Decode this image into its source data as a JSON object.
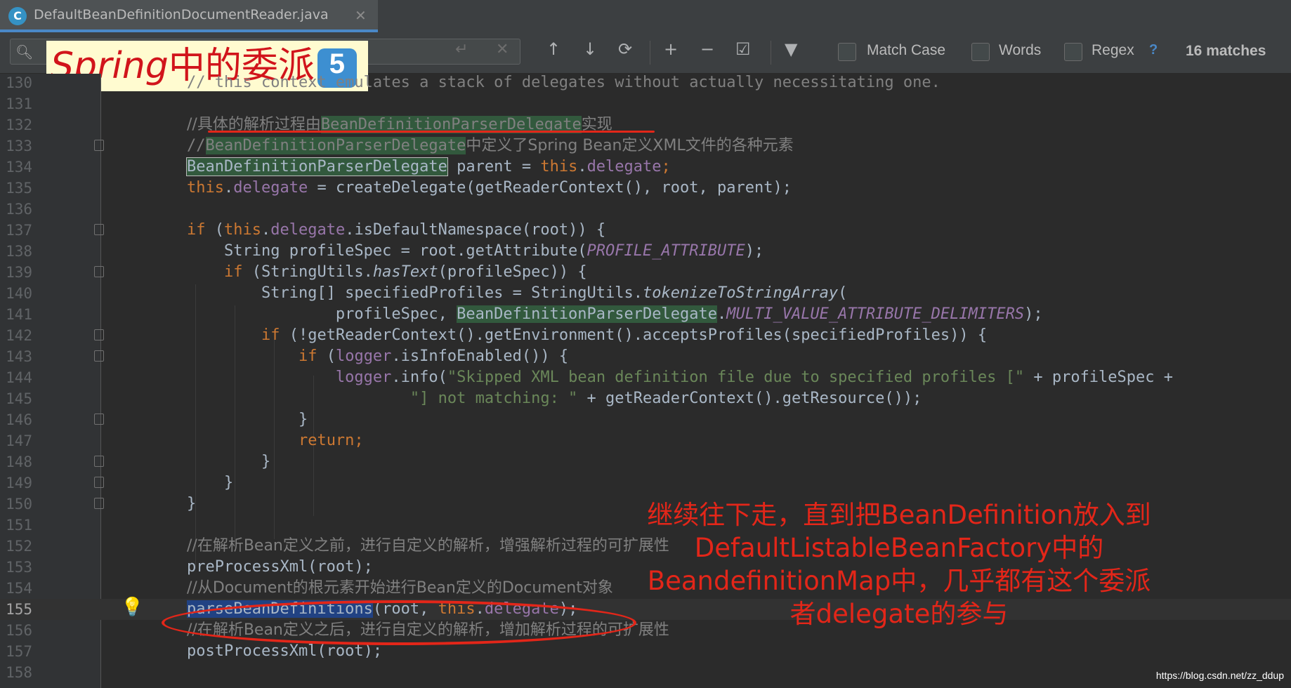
{
  "tab": {
    "icon_letter": "C",
    "title": "DefaultBeanDefinitionDocumentReader.java",
    "close": "✕"
  },
  "find": {
    "search_icon": "search-icon",
    "search_glyph": "🔍︎",
    "query": "",
    "enter_glyph": "↵",
    "clear_glyph": "✕",
    "up_glyph": "↑",
    "down_glyph": "↓",
    "all_glyph": "⟳",
    "add_glyph": "+",
    "remove_glyph": "−",
    "select_glyph": "☑",
    "filter_glyph": "▼",
    "match_case": "Match Case",
    "words": "Words",
    "regex": "Regex",
    "help": "?",
    "matches": "16 matches"
  },
  "overlay": {
    "title_latin": "Spring",
    "title_cjk": "中的委派",
    "badge": "5"
  },
  "lines": [
    {
      "n": "130"
    },
    {
      "n": "131"
    },
    {
      "n": "132"
    },
    {
      "n": "133"
    },
    {
      "n": "134"
    },
    {
      "n": "135"
    },
    {
      "n": "136"
    },
    {
      "n": "137"
    },
    {
      "n": "138"
    },
    {
      "n": "139"
    },
    {
      "n": "140"
    },
    {
      "n": "141"
    },
    {
      "n": "142"
    },
    {
      "n": "143"
    },
    {
      "n": "144"
    },
    {
      "n": "145"
    },
    {
      "n": "146"
    },
    {
      "n": "147"
    },
    {
      "n": "148"
    },
    {
      "n": "149"
    },
    {
      "n": "150"
    },
    {
      "n": "151"
    },
    {
      "n": "152"
    },
    {
      "n": "153"
    },
    {
      "n": "154"
    },
    {
      "n": "155"
    },
    {
      "n": "156"
    },
    {
      "n": "157"
    },
    {
      "n": "158"
    }
  ],
  "code": {
    "l130": "// this context emulates a stack of delegates without actually necessitating one.",
    "l132_a": "//具体的解析过程由",
    "l132_b": "BeanDefinitionParserDelegate",
    "l132_c": "实现",
    "l133_a": "//",
    "l133_b": "BeanDefinitionParserDelegate",
    "l133_c": "中定义了Spring Bean定义XML文件的各种元素",
    "l134_a": "BeanDefinitionParserDelegate",
    "l134_b": " parent = ",
    "l134_c": "this",
    "l134_d": ".",
    "l134_e": "delegate",
    "l134_f": ";",
    "l135_a": "this",
    "l135_b": ".",
    "l135_c": "delegate",
    "l135_d": " = createDelegate(getReaderContext(), root, parent);",
    "l137_a": "if",
    "l137_b": " (",
    "l137_c": "this",
    "l137_d": ".",
    "l137_e": "delegate",
    "l137_f": ".isDefaultNamespace(root)) {",
    "l138_a": "    String profileSpec = root.getAttribute(",
    "l138_b": "PROFILE_ATTRIBUTE",
    "l138_c": ");",
    "l139_a": "    ",
    "l139_b": "if",
    "l139_c": " (StringUtils.",
    "l139_d": "hasText",
    "l139_e": "(profileSpec)) {",
    "l140_a": "        String[] specifiedProfiles = StringUtils.",
    "l140_b": "tokenizeToStringArray",
    "l140_c": "(",
    "l141_a": "                profileSpec, ",
    "l141_b": "BeanDefinitionParserDelegate",
    "l141_c": ".",
    "l141_d": "MULTI_VALUE_ATTRIBUTE_DELIMITERS",
    "l141_e": ");",
    "l142_a": "        ",
    "l142_b": "if",
    "l142_c": " (!getReaderContext().getEnvironment().acceptsProfiles(specifiedProfiles)) {",
    "l143_a": "            ",
    "l143_b": "if",
    "l143_c": " (",
    "l143_d": "logger",
    "l143_e": ".isInfoEnabled()) {",
    "l144_a": "                ",
    "l144_b": "logger",
    "l144_c": ".info(",
    "l144_d": "\"Skipped XML bean definition file due to specified profiles [\"",
    "l144_e": " + profileSpec +",
    "l145_a": "                        ",
    "l145_b": "\"] not matching: \"",
    "l145_c": " + getReaderContext().getResource());",
    "l146": "            }",
    "l147_a": "            ",
    "l147_b": "return;",
    "l148": "        }",
    "l149": "    }",
    "l150": "}",
    "l152": "//在解析Bean定义之前，进行自定义的解析，增强解析过程的可扩展性",
    "l153": "preProcessXml(root);",
    "l154": "//从Document的根元素开始进行Bean定义的Document对象",
    "l155_a": "parseBeanDefinitions",
    "l155_b": "(root, ",
    "l155_c": "this",
    "l155_d": ".",
    "l155_e": "delegate",
    "l155_f": ");",
    "l156": "//在解析Bean定义之后，进行自定义的解析，增加解析过程的可扩展性",
    "l157": "postProcessXml(root);"
  },
  "annotation": {
    "note": "继续往下走，直到把BeanDefinition放入到DefaultListableBeanFactory中的BeandefinitionMap中，几乎都有这个委派者delegate的参与",
    "bulb": "💡"
  },
  "watermark": "https://blog.csdn.net/zz_ddup",
  "colors": {
    "accent": "#4a88c7",
    "annotation_red": "#e32619",
    "title_bg": "#fffbd0"
  }
}
